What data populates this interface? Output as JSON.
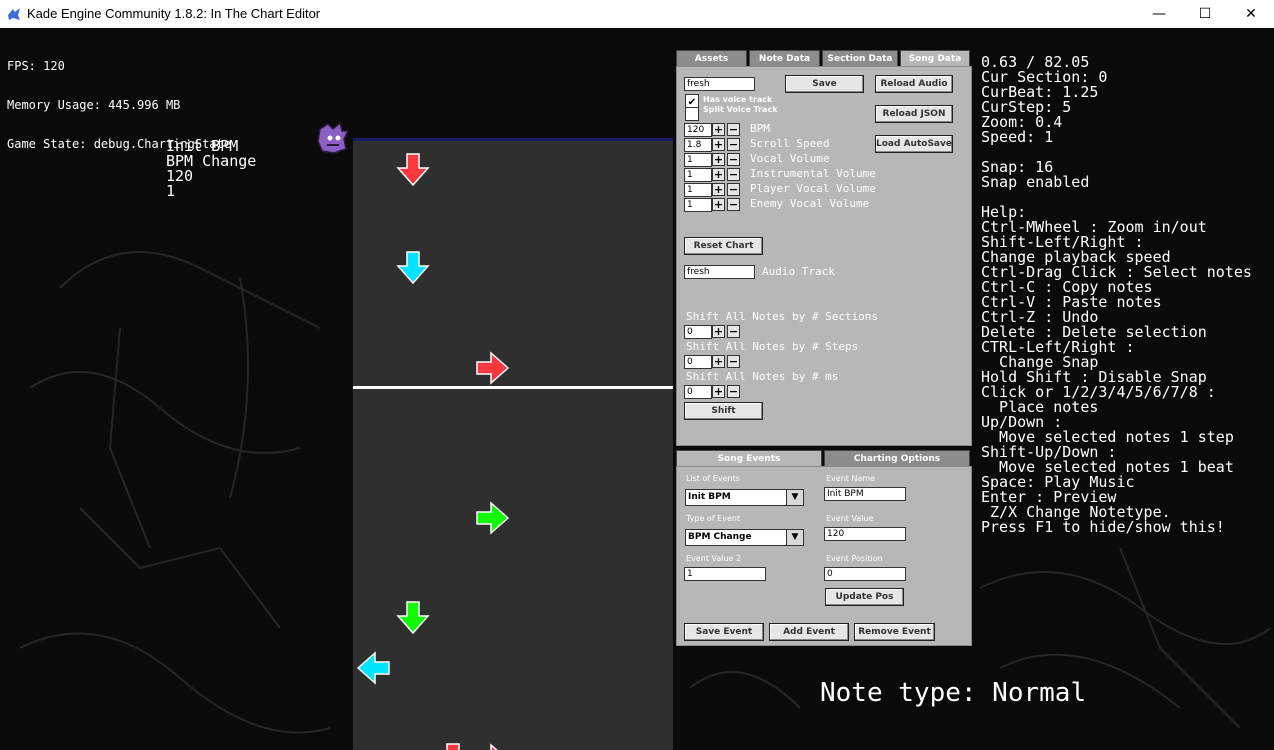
{
  "window": {
    "title": "Kade Engine Community 1.8.2: In The Chart Editor",
    "minimize": "—",
    "maximize": "☐",
    "close": "✕"
  },
  "debug": {
    "fps": "FPS: 120",
    "memory": "Memory Usage: 445.996 MB",
    "state": "Game State: debug.ChartingState"
  },
  "event_info": {
    "line1": "Init BPM",
    "line2": "BPM Change",
    "line3": "120",
    "line4": "1"
  },
  "top_panel": {
    "tabs": [
      "Assets",
      "Note Data",
      "Section Data",
      "Song Data"
    ],
    "active_tab": "Song Data",
    "song_name": "fresh",
    "save": "Save",
    "reload_audio": "Reload Audio",
    "reload_json": "Reload JSON",
    "load_autosave": "Load AutoSave",
    "has_voice_track": "Has voice track",
    "has_voice_checked": "✔",
    "split_voice_track": "Split Voice Track",
    "steppers": [
      {
        "value": "120",
        "label": "BPM"
      },
      {
        "value": "1.8",
        "label": "Scroll Speed"
      },
      {
        "value": "1",
        "label": "Vocal Volume"
      },
      {
        "value": "1",
        "label": "Instrumental Volume"
      },
      {
        "value": "1",
        "label": "Player Vocal Volume"
      },
      {
        "value": "1",
        "label": "Enemy Vocal Volume"
      }
    ],
    "plus": "+",
    "minus": "−",
    "reset_chart": "Reset Chart",
    "audio_track_value": "fresh",
    "audio_track_label": "Audio Track",
    "shift_sections_label": "Shift All Notes by # Sections",
    "shift_sections_value": "0",
    "shift_steps_label": "Shift All Notes by # Steps",
    "shift_steps_value": "0",
    "shift_ms_label": "Shift All Notes by # ms",
    "shift_ms_value": "0",
    "shift": "Shift"
  },
  "bottom_panel": {
    "tabs": [
      "Song Events",
      "Charting Options"
    ],
    "active_tab": "Song Events",
    "list_of_events_label": "List of Events",
    "list_of_events_value": "Init BPM",
    "event_name_label": "Event Name",
    "event_name_value": "Init BPM",
    "type_of_event_label": "Type of Event",
    "type_of_event_value": "BPM Change",
    "event_value_label": "Event Value",
    "event_value_value": "120",
    "event_value2_label": "Event Value 2",
    "event_value2_value": "1",
    "event_position_label": "Event Position",
    "event_position_value": "0",
    "update_pos": "Update Pos",
    "save_event": "Save Event",
    "add_event": "Add Event",
    "remove_event": "Remove Event",
    "dropdown_arrow": "▼"
  },
  "info_right": [
    "0.63 / 82.05",
    "Cur Section: 0",
    "CurBeat: 1.25",
    "CurStep: 5",
    "Zoom: 0.4",
    "Speed: 1",
    "",
    "Snap: 16",
    "Snap enabled",
    "",
    "Help:",
    "Ctrl-MWheel : Zoom in/out",
    "Shift-Left/Right :",
    "Change playback speed",
    "Ctrl-Drag Click : Select notes",
    "Ctrl-C : Copy notes",
    "Ctrl-V : Paste notes",
    "Ctrl-Z : Undo",
    "Delete : Delete selection",
    "CTRL-Left/Right :",
    "  Change Snap",
    "Hold Shift : Disable Snap",
    "Click or 1/2/3/4/5/6/7/8 :",
    "  Place notes",
    "Up/Down :",
    "  Move selected notes 1 step",
    "Shift-Up/Down :",
    "  Move selected notes 1 beat",
    "Space: Play Music",
    "Enter : Preview",
    " Z/X Change Notetype.",
    "Press F1 to hide/show this!"
  ],
  "note_type": "Note type: Normal",
  "colors": {
    "left_arrow": "#c24b99",
    "down_arrow": "#00ffff",
    "up_arrow": "#12fa05",
    "right_arrow": "#f9393f",
    "grid": "#2f2f2f",
    "panel": "#b7b7b7"
  },
  "notes": [
    {
      "direction": "down",
      "color": "#f9393f"
    },
    {
      "direction": "down",
      "color": "#00e5ff"
    },
    {
      "direction": "right",
      "color": "#f9393f"
    },
    {
      "direction": "right",
      "color": "#12fa05"
    },
    {
      "direction": "down",
      "color": "#12fa05"
    },
    {
      "direction": "left",
      "color": "#00e5ff"
    }
  ]
}
